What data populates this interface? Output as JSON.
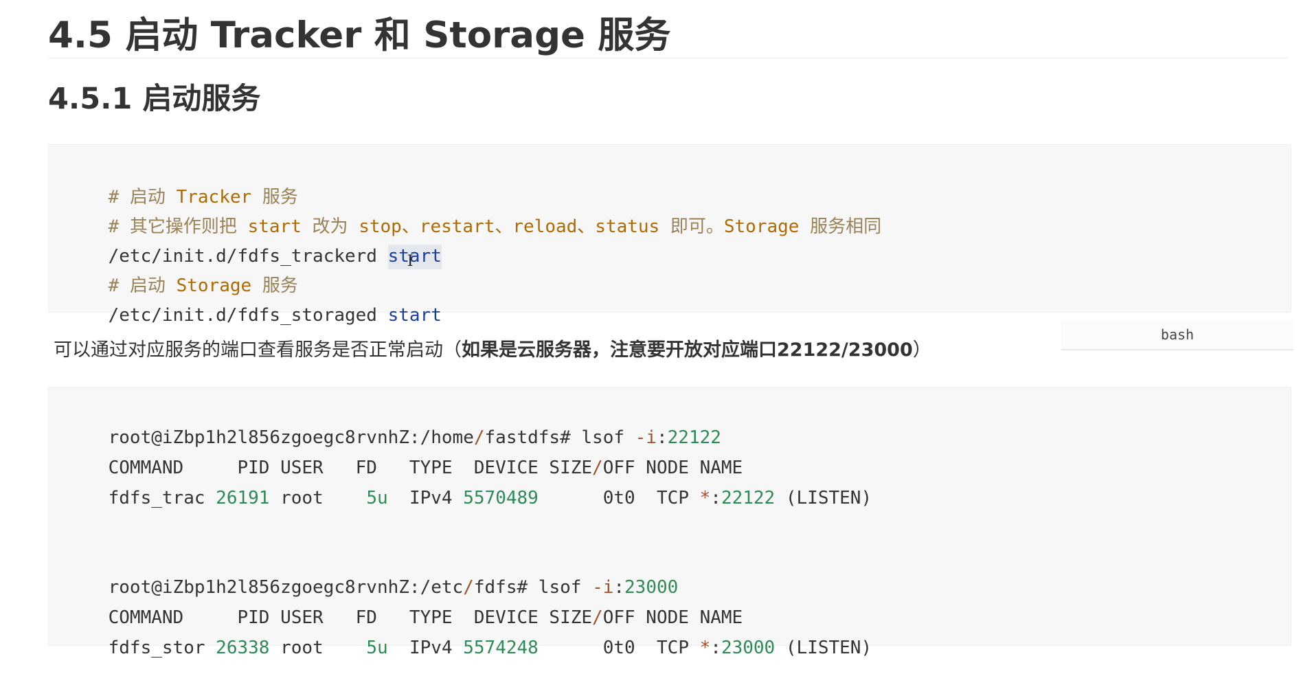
{
  "headings": {
    "h2": "4.5 启动 Tracker 和 Storage 服务",
    "h3": "4.5.1 启动服务"
  },
  "code_block_1": {
    "lang_label": "bash",
    "lines": {
      "l1": {
        "prefix": "# 启动 ",
        "kw": "Tracker",
        "suffix": " 服务"
      },
      "l2": {
        "prefix": "# 其它操作则把 ",
        "kw1": "start",
        "mid1": " 改为 ",
        "kw2": "stop、restart、reload、status",
        "mid2": " 即可。",
        "kw3": "Storage",
        "suffix": " 服务相同"
      },
      "l3": {
        "path": "/etc/init.d/fdfs_trackerd ",
        "cmd": "start"
      },
      "l4": {
        "prefix": "# 启动 ",
        "kw": "Storage",
        "suffix": " 服务"
      },
      "l5": {
        "path": "/etc/init.d/fdfs_storaged ",
        "cmd": "start"
      }
    }
  },
  "paragraph": {
    "text": "可以通过对应服务的端口查看服务是否正常启动（",
    "bold": "如果是云服务器，注意要开放对应端口22122/23000",
    "close": "）"
  },
  "code_block_2": {
    "prompt1": {
      "user": "root@iZbp1h2l856zgoegc8rvnhZ:",
      "path_a": "/home",
      "slash": "/",
      "path_b": "fastdfs",
      "cmd": "# lsof ",
      "flag": "-i",
      "colon": ":",
      "port": "22122"
    },
    "header1": {
      "a": "COMMAND     PID USER   FD   TYPE  DEVICE SIZE",
      "slash": "/",
      "b": "OFF NODE NAME"
    },
    "row1": {
      "cmd": "fdfs_trac ",
      "pid": "26191",
      "user_fd": " root    ",
      "fd": "5u",
      "type": "  IPv4 ",
      "device": "5570489",
      "size": "      0t0",
      "node": "  TCP ",
      "star": "*",
      "colon": ":",
      "port": "22122",
      "state": " (LISTEN)"
    },
    "prompt2": {
      "user": "root@iZbp1h2l856zgoegc8rvnhZ:",
      "path_a": "/etc",
      "slash": "/",
      "path_b": "fdfs",
      "cmd": "# lsof ",
      "flag": "-i",
      "colon": ":",
      "port": "23000"
    },
    "header2": {
      "a": "COMMAND     PID USER   FD   TYPE  DEVICE SIZE",
      "slash": "/",
      "b": "OFF NODE NAME"
    },
    "row2": {
      "cmd": "fdfs_stor ",
      "pid": "26338",
      "user_fd": " root    ",
      "fd": "5u",
      "type": "  IPv4 ",
      "device": "5574248",
      "size": "      0t0",
      "node": "  TCP ",
      "star": "*",
      "colon": ":",
      "port": "23000",
      "state": " (LISTEN)"
    }
  },
  "colors": {
    "keyword": "#b06a00",
    "comment": "#8a6d3b",
    "number": "#2e8b57",
    "code_bg": "#f7f7f7"
  }
}
